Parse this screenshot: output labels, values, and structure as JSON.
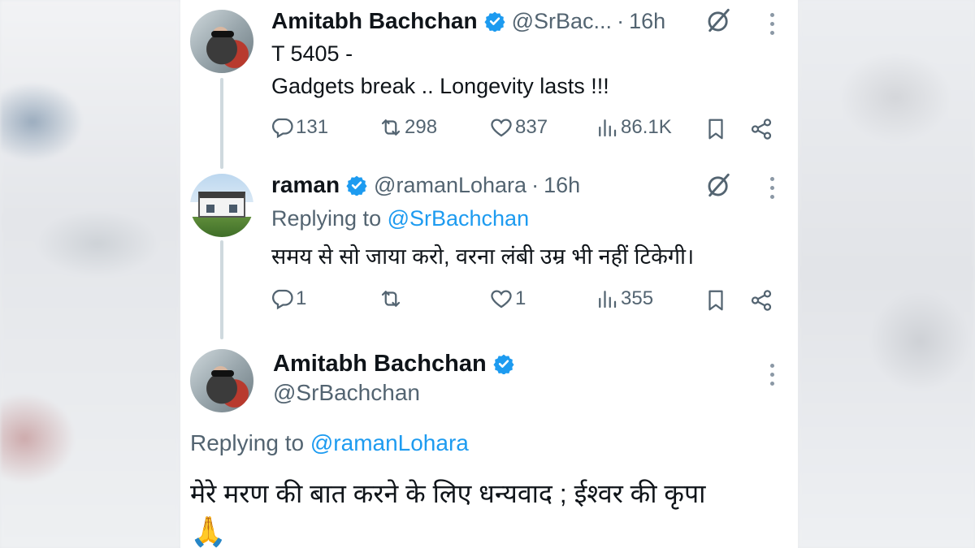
{
  "colors": {
    "accent": "#1d9bf0",
    "muted": "#536471",
    "text": "#0f1419",
    "line": "#cfd9de"
  },
  "tweets": [
    {
      "name": "Amitabh Bachchan",
      "handle": "@SrBac...",
      "time": "16h",
      "lines": [
        "T 5405 -",
        "Gadgets break .. Longevity lasts  !!!"
      ],
      "replies": "131",
      "reposts": "298",
      "likes": "837",
      "views": "86.1K"
    },
    {
      "name": "raman",
      "handle": "@ramanLohara",
      "time": "16h",
      "replying_prefix": "Replying to ",
      "replying_to": "@SrBachchan",
      "text": "समय से सो जाया करो, वरना लंबी उम्र भी नहीं टिकेगी।",
      "replies": "1",
      "reposts": "",
      "likes": "1",
      "views": "355"
    }
  ],
  "focused": {
    "name": "Amitabh Bachchan",
    "handle": "@SrBachchan",
    "replying_prefix": "Replying to ",
    "replying_to": "@ramanLohara",
    "text": "मेरे मरण की बात करने के लिए धन्यवाद  ; ईश्वर  की कृपा",
    "emoji": "🙏"
  },
  "icons": [
    "verified-badge-icon",
    "grok-icon",
    "more-icon",
    "reply-icon",
    "repost-icon",
    "like-icon",
    "views-icon",
    "bookmark-icon",
    "share-icon"
  ]
}
